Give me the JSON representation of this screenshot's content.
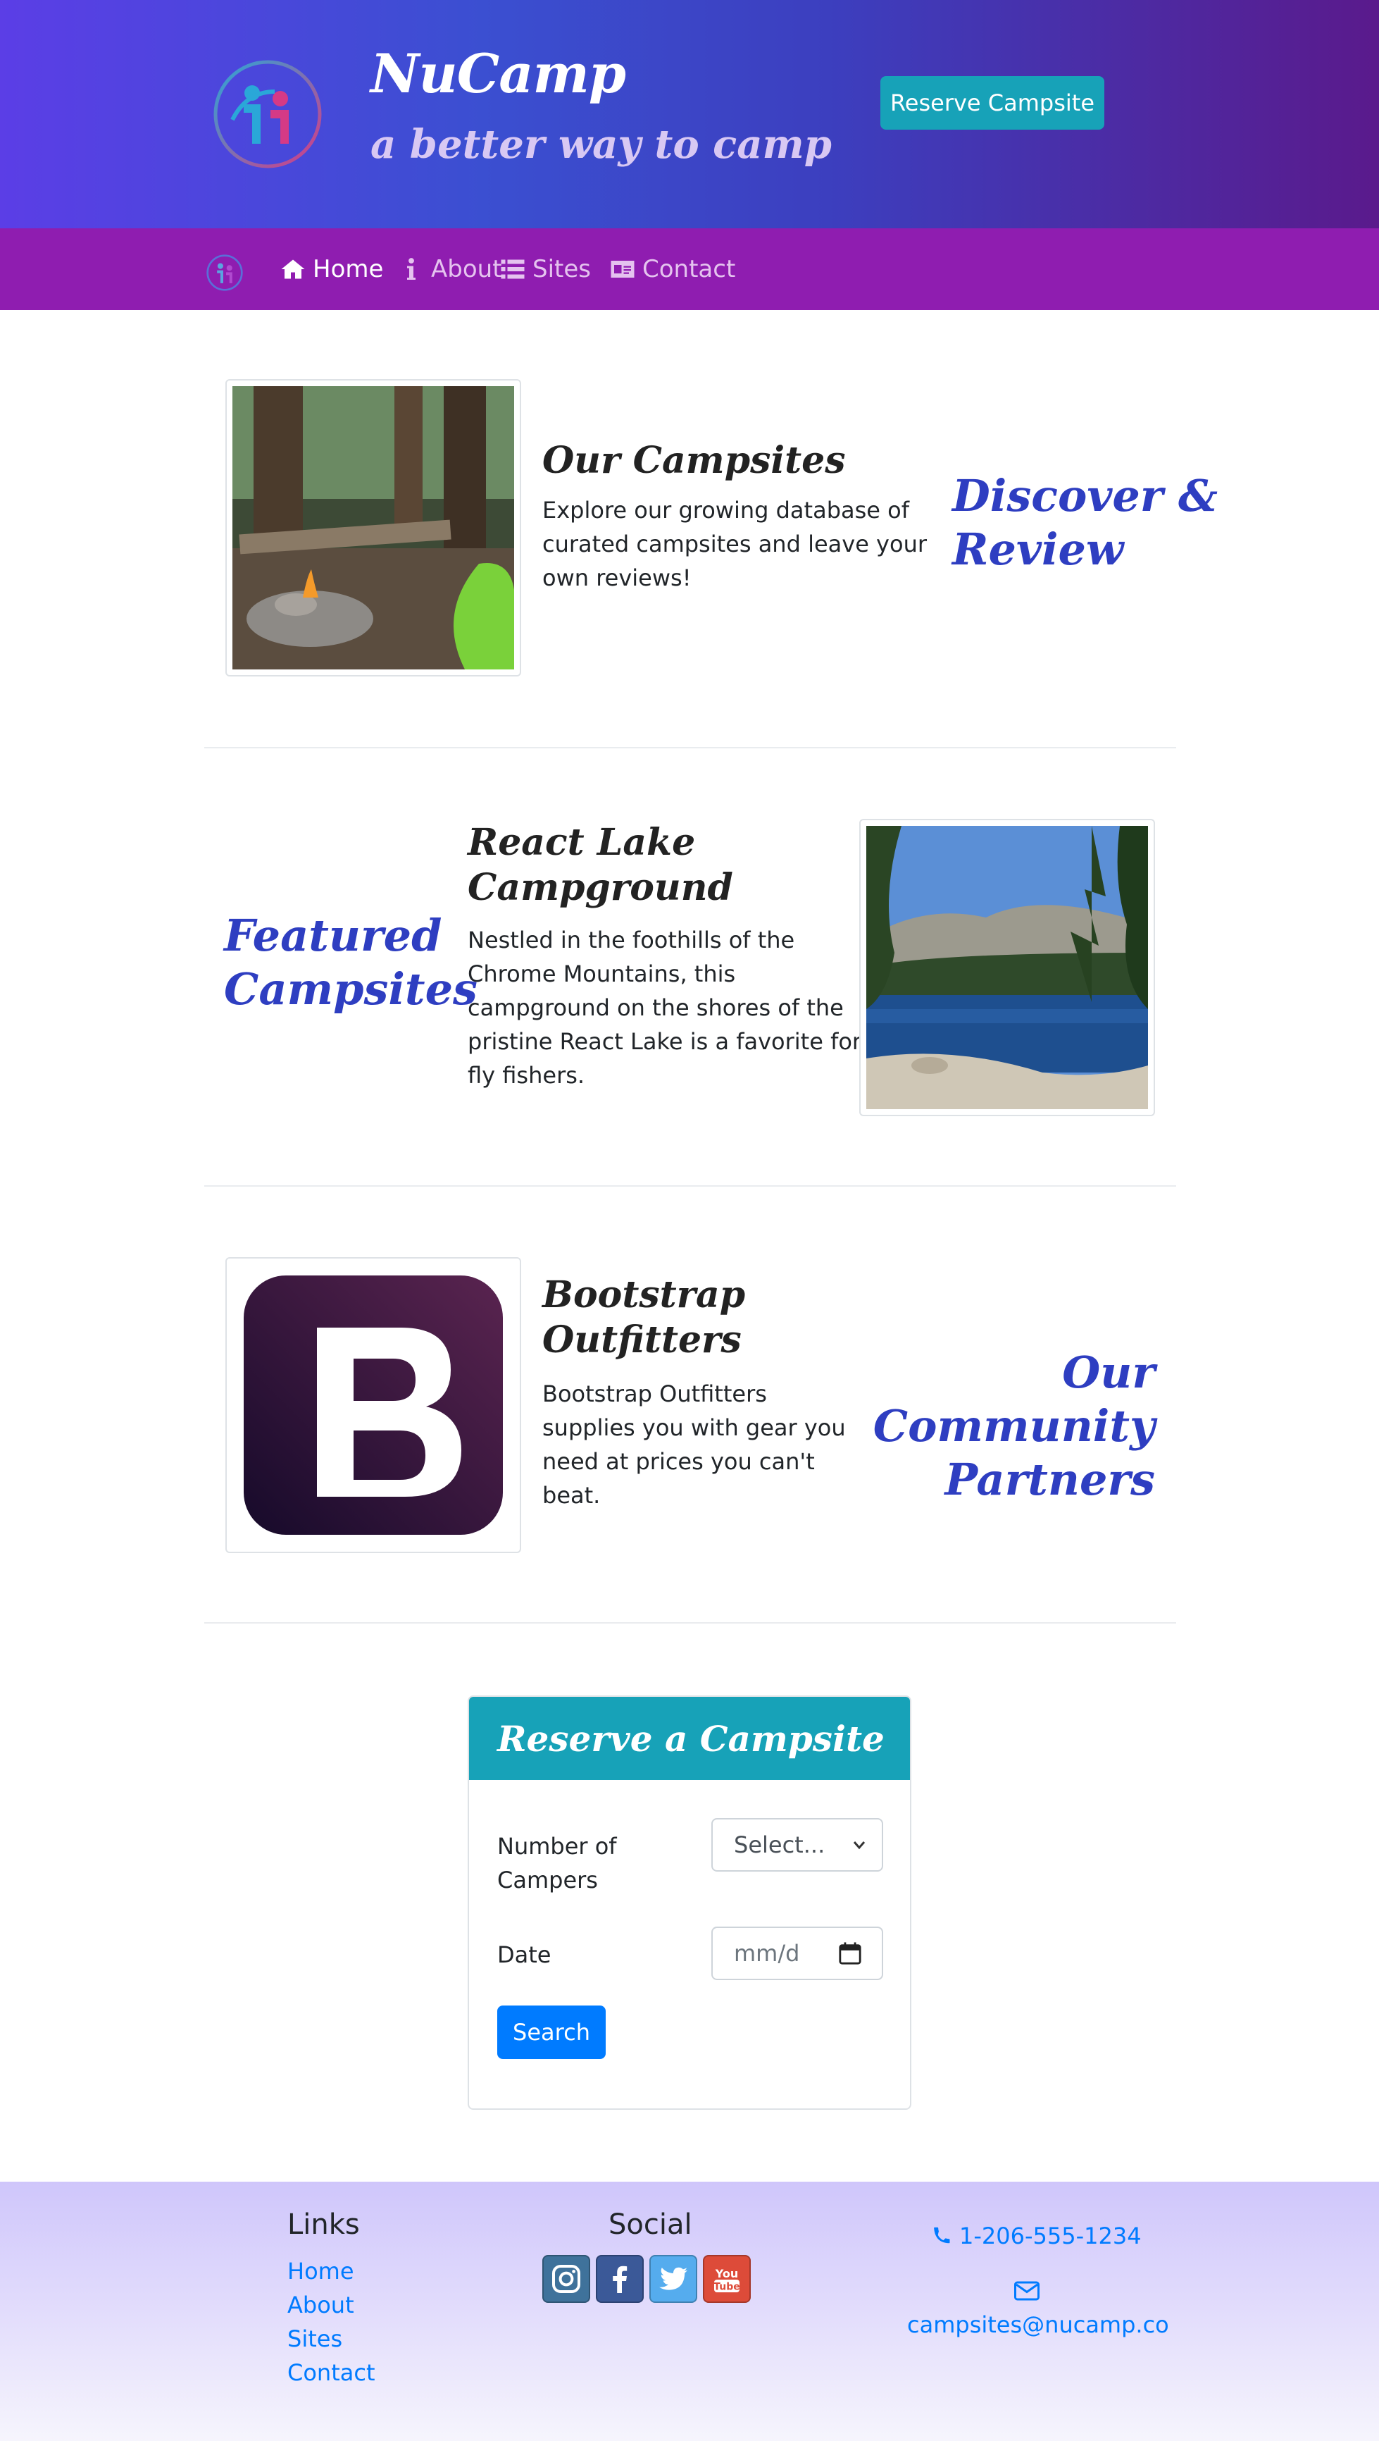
{
  "header": {
    "title": "NuCamp",
    "subtitle": "a better way to camp",
    "reserve_button": "Reserve Campsite"
  },
  "nav": {
    "items": [
      {
        "label": "Home",
        "icon": "home-icon",
        "active": true
      },
      {
        "label": "About",
        "icon": "info-icon",
        "active": false
      },
      {
        "label": "Sites",
        "icon": "list-icon",
        "active": false
      },
      {
        "label": "Contact",
        "icon": "address-card-icon",
        "active": false
      }
    ]
  },
  "sections": [
    {
      "title": "Our Campsites",
      "text": [
        "Explore our growing database of",
        "curated campsites and leave your",
        "own reviews!"
      ],
      "accent": [
        "Discover &",
        "Review"
      ],
      "image": "campfire-photo"
    },
    {
      "title": [
        "React Lake",
        "Campground"
      ],
      "text": [
        "Nestled in the foothills of the",
        "Chrome Mountains, this",
        "campground on the shores of the",
        "pristine React Lake is a favorite for",
        "fly fishers."
      ],
      "accent": [
        "Featured",
        "Campsites"
      ],
      "image": "lake-photo"
    },
    {
      "title": [
        "Bootstrap",
        "Outfitters"
      ],
      "text": [
        "Bootstrap Outfitters",
        "supplies you with gear you",
        "need at prices you can't",
        "beat."
      ],
      "accent": [
        "Our Community",
        "Partners"
      ],
      "image": "bootstrap-logo"
    }
  ],
  "reserve_form": {
    "title": "Reserve a Campsite",
    "campers_label": [
      "Number of",
      "Campers"
    ],
    "campers_value": "Select...",
    "date_label": "Date",
    "date_placeholder": "mm/d",
    "search_button": "Search"
  },
  "footer": {
    "links_heading": "Links",
    "links": [
      "Home",
      "About",
      "Sites",
      "Contact"
    ],
    "social_heading": "Social",
    "social": [
      {
        "icon": "instagram-icon",
        "color": "#3f729b"
      },
      {
        "icon": "facebook-icon",
        "color": "#3b5998"
      },
      {
        "icon": "twitter-icon",
        "color": "#55acee"
      },
      {
        "icon": "youtube-icon",
        "color": "#dd4b39"
      }
    ],
    "phone": "1-206-555-1234",
    "email": "campsites@nucamp.co"
  },
  "colors": {
    "accent": "#2e3ec1",
    "navbar": "#8f1db0",
    "teal": "#17a2b8",
    "link": "#007bff"
  }
}
